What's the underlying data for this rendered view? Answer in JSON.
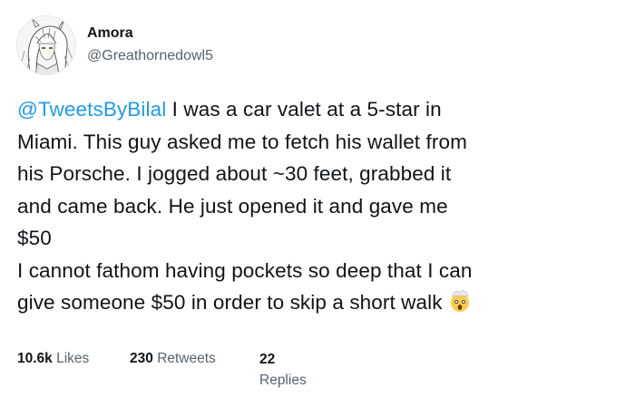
{
  "tweet": {
    "author_name": "Amora",
    "author_handle": "@Greathornedowl5",
    "avatar_icon": "anime-character-avatar-icon",
    "mention": "@TweetsByBilal",
    "lines": [
      " I was a car valet at a 5-star in",
      "Miami. This guy asked me to fetch his wallet from",
      "his Porsche. I jogged about ~30 feet, grabbed it",
      "and came back. He just opened it and gave me",
      "$50",
      "I cannot fathom having pockets so deep that I can",
      "give someone $50 in order to skip a short walk"
    ],
    "emoji_icon": "exploding-head-emoji-icon"
  },
  "stats": {
    "likes_count": "10.6k",
    "likes_label": "Likes",
    "retweets_count": "230",
    "retweets_label": "Retweets",
    "replies_count": "22",
    "replies_label": "Replies"
  },
  "colors": {
    "mention": "#1d9bf0",
    "secondary_text": "#536471",
    "primary_text": "#0f1419"
  }
}
